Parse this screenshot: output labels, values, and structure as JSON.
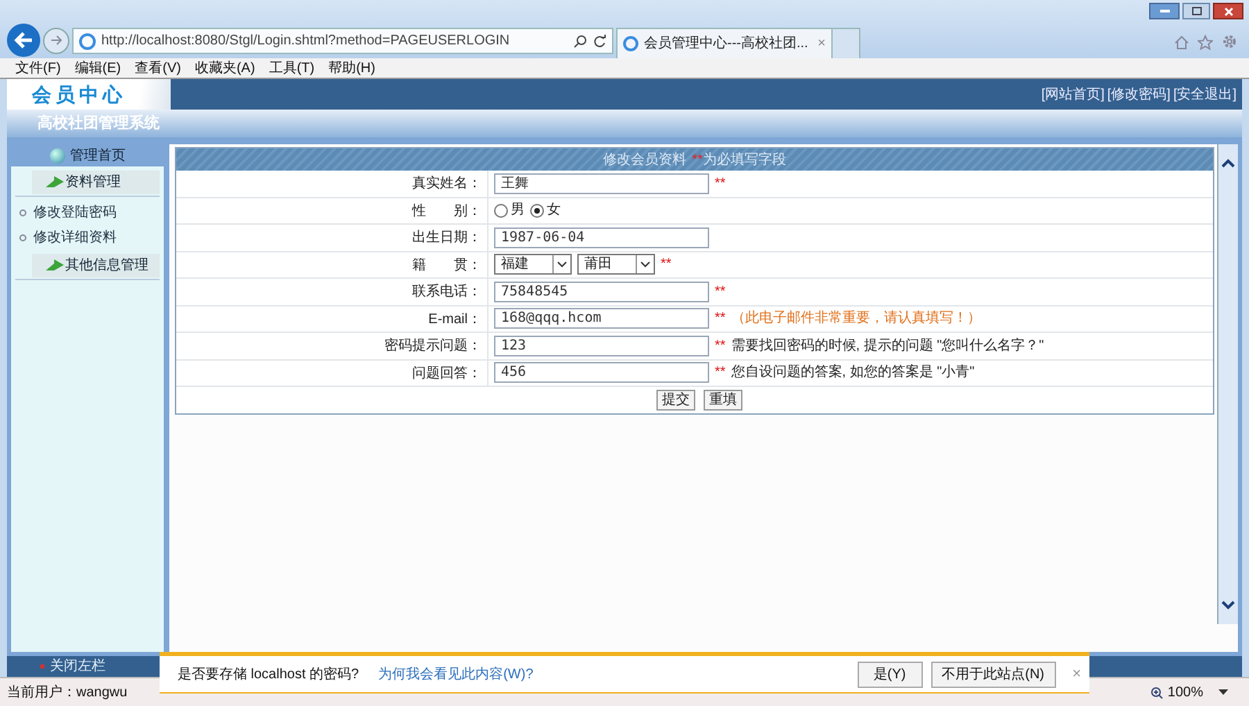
{
  "browser": {
    "address": "http://localhost:8080/Stgl/Login.shtml?method=PAGEUSERLOGIN",
    "tabs": [
      {
        "title": "会员管理中心---高校社团...",
        "selected": true,
        "close": "×"
      }
    ]
  },
  "menu": [
    "文件(F)",
    "编辑(E)",
    "查看(V)",
    "收藏夹(A)",
    "工具(T)",
    "帮助(H)"
  ],
  "header": {
    "logo": "会员中心",
    "links": [
      "[网站首页]",
      "[修改密码]",
      "[安全退出]"
    ],
    "system_title": "高校社团管理系统"
  },
  "sidebar": {
    "home": "管理首页",
    "sections": [
      {
        "title": "资料管理",
        "items": [
          "修改登陆密码",
          "修改详细资料"
        ]
      },
      {
        "title": "其他信息管理"
      }
    ]
  },
  "form": {
    "title": "修改会员资料",
    "required_mark": "**",
    "required_note": "为必填写字段",
    "rows": [
      {
        "kind": "text",
        "label": "真实姓名：",
        "value": "王舞",
        "required": true
      },
      {
        "kind": "radio",
        "label": "性　　别：",
        "options": [
          {
            "label": "男",
            "selected": false
          },
          {
            "label": "女",
            "selected": true
          }
        ],
        "required": false
      },
      {
        "kind": "text",
        "label": "出生日期：",
        "value": "1987-06-04",
        "required": false
      },
      {
        "kind": "select",
        "label": "籍　　贯：",
        "selects": [
          "福建",
          "莆田"
        ],
        "required": true
      },
      {
        "kind": "text",
        "label": "联系电话：",
        "value": "75848545",
        "required": true
      },
      {
        "kind": "text",
        "label": "E-mail：",
        "value": "168@qqq.hcom",
        "required": true,
        "hint": "（此电子邮件非常重要，请认真填写！）",
        "warning": true
      },
      {
        "kind": "text",
        "label": "密码提示问题：",
        "value": "123",
        "required": true,
        "hint": "需要找回密码的时候, 提示的问题 \"您叫什么名字？\"",
        "warning": false
      },
      {
        "kind": "text",
        "label": "问题回答：",
        "value": "456",
        "required": true,
        "hint": "您自设问题的答案, 如您的答案是 \"小青\"",
        "warning": false
      }
    ],
    "buttons": [
      "提交",
      "重填"
    ]
  },
  "bottom_bar": {
    "toggle": "关闭左栏"
  },
  "status_bar": {
    "user": "当前用户：wangwu",
    "zoom": "100%"
  },
  "notification": {
    "message": "是否要存储 localhost 的密码?",
    "link": "为何我会看见此内容(W)?",
    "buttons": [
      "是(Y)",
      "不用于此站点(N)"
    ],
    "close": "×"
  }
}
